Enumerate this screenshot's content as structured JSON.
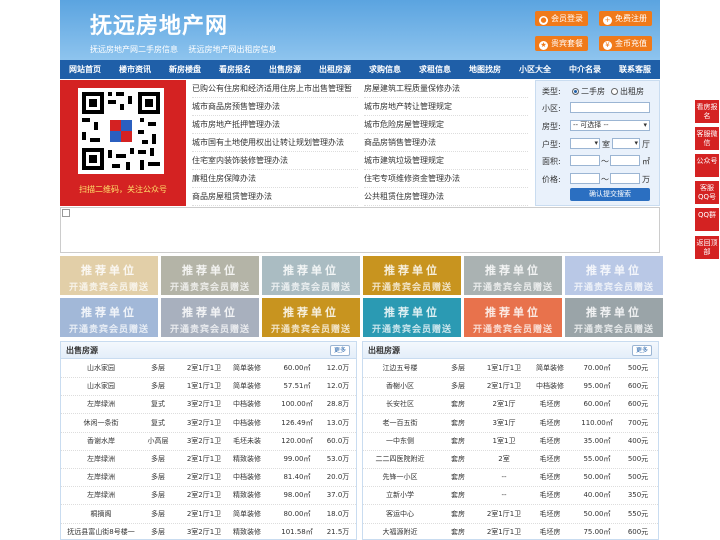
{
  "header": {
    "title": "抚远房地产网",
    "links": [
      "抚远房地产网二手房信息",
      "抚远房地产网出租房信息"
    ],
    "buttons": [
      {
        "label": "会员登录",
        "icon": "user-icon"
      },
      {
        "label": "免费注册",
        "icon": "register-icon"
      },
      {
        "label": "贵宾套餐",
        "icon": "vip-icon"
      },
      {
        "label": "金币充值",
        "icon": "coin-icon"
      }
    ],
    "accent": "#f07a1a"
  },
  "nav": [
    "网站首页",
    "楼市资讯",
    "新房楼盘",
    "看房报名",
    "出售房源",
    "出租房源",
    "求购信息",
    "求租信息",
    "地图找房",
    "小区大全",
    "中介名录",
    "联系客服"
  ],
  "qr": {
    "caption": "扫描二维码，关注公众号"
  },
  "news": {
    "left": [
      "已购公有住房和经济适用住房上市出售管理暂",
      "城市商品房预售管理办法",
      "城市房地产抵押管理办法",
      "城市国有土地使用权出让转让规划管理办法",
      "住宅室内装饰装修管理办法",
      "廉租住房保障办法",
      "商品房屋租赁管理办法"
    ],
    "right": [
      "房屋建筑工程质量保修办法",
      "城市房地产转让管理规定",
      "城市危险房屋管理规定",
      "商品房销售管理办法",
      "城市建筑垃圾管理规定",
      "住宅专项维修资金管理办法",
      "公共租赁住房管理办法"
    ]
  },
  "search": {
    "type_label": "类型:",
    "radio_options": [
      "二手房",
      "出租房"
    ],
    "community_label": "小区:",
    "house_type_label": "房型:",
    "house_type_value": "-- 可选择 --",
    "layout_label": "户型:",
    "room_unit": "室",
    "hall_unit": "厅",
    "area_label": "面积:",
    "area_unit": "㎡",
    "price_label": "价格:",
    "price_unit": "万",
    "range_sep": "〜",
    "submit_label": "确认提交搜索"
  },
  "tiles": {
    "line1": "推荐单位",
    "line2": "开通贵宾会员赠送",
    "colors": [
      "#e2cfa8",
      "#b4b4a7",
      "#aabcc2",
      "#c8941f",
      "#aab2b2",
      "#b9c8e6",
      "#a2b8d8",
      "#a8b0be",
      "#c8941f",
      "#2b9ab3",
      "#e8724c",
      "#9aa4a8"
    ]
  },
  "sale": {
    "title": "出售房源",
    "more": "更多",
    "rows": [
      [
        "山水家园",
        "多层",
        "2室1厅1卫",
        "简单装修",
        "60.00㎡",
        "12.0万"
      ],
      [
        "山水家园",
        "多层",
        "1室1厅1卫",
        "简单装修",
        "57.51㎡",
        "12.0万"
      ],
      [
        "左岸绿洲",
        "复式",
        "3室2厅1卫",
        "中档装修",
        "100.00㎡",
        "28.8万"
      ],
      [
        "休闲一条街",
        "复式",
        "3室2厅1卫",
        "中档装修",
        "126.49㎡",
        "13.0万"
      ],
      [
        "香谢水岸",
        "小高层",
        "3室2厅1卫",
        "毛坯未装",
        "120.00㎡",
        "60.0万"
      ],
      [
        "左岸绿洲",
        "多层",
        "2室1厅1卫",
        "精致装修",
        "99.00㎡",
        "53.0万"
      ],
      [
        "左岸绿洲",
        "多层",
        "2室2厅1卫",
        "中档装修",
        "81.40㎡",
        "20.0万"
      ],
      [
        "左岸绿洲",
        "多层",
        "2室2厅1卫",
        "精致装修",
        "98.00㎡",
        "37.0万"
      ],
      [
        "桐摘阁",
        "多层",
        "2室1厅1卫",
        "简单装修",
        "80.00㎡",
        "18.0万"
      ],
      [
        "抚远县富山街8号楼一",
        "多层",
        "3室2厅1卫",
        "精致装修",
        "101.58㎡",
        "21.5万"
      ]
    ]
  },
  "rent": {
    "title": "出租房源",
    "more": "更多",
    "rows": [
      [
        "江边五号楼",
        "多层",
        "1室1厅1卫",
        "简单装修",
        "70.00㎡",
        "500元"
      ],
      [
        "香榭小区",
        "多层",
        "2室1厅1卫",
        "中档装修",
        "95.00㎡",
        "600元"
      ],
      [
        "长安社区",
        "套房",
        "2室1厅",
        "毛坯房",
        "60.00㎡",
        "600元"
      ],
      [
        "老一百五街",
        "套房",
        "3室1厅",
        "毛坯房",
        "110.00㎡",
        "700元"
      ],
      [
        "一中东侧",
        "套房",
        "1室1卫",
        "毛坯房",
        "35.00㎡",
        "400元"
      ],
      [
        "二二四医院附近",
        "套房",
        "2室",
        "毛坯房",
        "55.00㎡",
        "500元"
      ],
      [
        "先锋一小区",
        "套房",
        "--",
        "毛坯房",
        "50.00㎡",
        "500元"
      ],
      [
        "立新小学",
        "套房",
        "--",
        "毛坯房",
        "40.00㎡",
        "350元"
      ],
      [
        "客运中心",
        "套房",
        "2室1厅1卫",
        "毛坯房",
        "50.00㎡",
        "550元"
      ],
      [
        "大福源附近",
        "套房",
        "2室1厅1卫",
        "毛坯房",
        "75.00㎡",
        "600元"
      ]
    ]
  },
  "side": [
    "看房报名",
    "客服微信",
    "公众号",
    "客服QQ号",
    "QQ群",
    "返回顶部"
  ]
}
